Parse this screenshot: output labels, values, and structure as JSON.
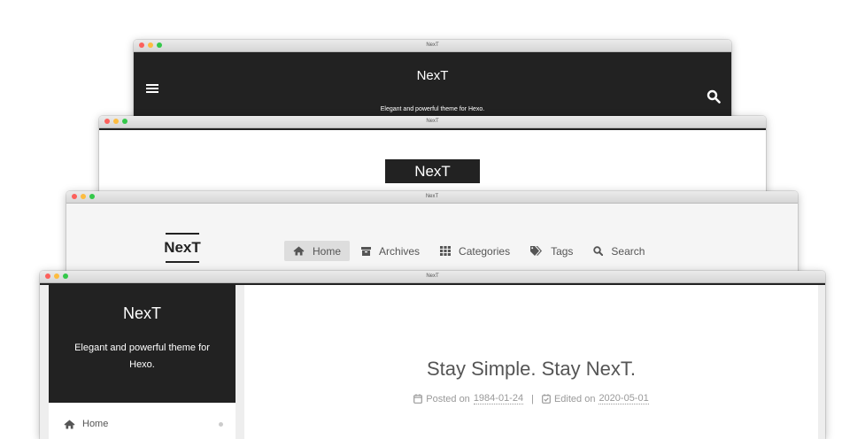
{
  "window_title": "NexT",
  "window1": {
    "site_title": "NexT",
    "subtitle": "Elegant and powerful theme for Hexo.",
    "menu_icon": "hamburger-icon",
    "search_icon": "search-icon"
  },
  "window2": {
    "site_title": "NexT"
  },
  "window3": {
    "site_title": "NexT",
    "nav": [
      {
        "label": "Home",
        "icon": "home-icon",
        "active": true
      },
      {
        "label": "Archives",
        "icon": "archive-icon",
        "active": false
      },
      {
        "label": "Categories",
        "icon": "grid-icon",
        "active": false
      },
      {
        "label": "Tags",
        "icon": "tags-icon",
        "active": false
      },
      {
        "label": "Search",
        "icon": "search-icon",
        "active": false
      }
    ]
  },
  "window4": {
    "site_title": "NexT",
    "subtitle": "Elegant and powerful theme for Hexo.",
    "menu": [
      {
        "label": "Home",
        "icon": "home-icon"
      }
    ],
    "post": {
      "title": "Stay Simple. Stay NexT.",
      "posted_label": "Posted on",
      "posted_date": "1984-01-24",
      "separator": "|",
      "edited_label": "Edited on",
      "edited_date": "2020-05-01"
    }
  },
  "colors": {
    "dark": "#222222",
    "text": "#555555",
    "muted": "#999999",
    "light_bg": "#f5f5f5"
  }
}
